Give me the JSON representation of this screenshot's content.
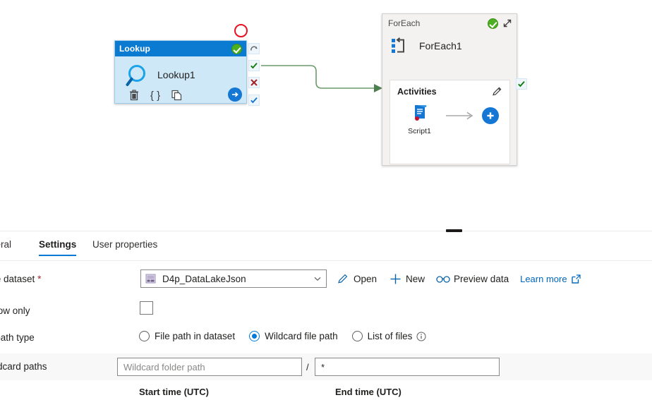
{
  "canvas": {
    "lookup_node": {
      "header_title": "Lookup",
      "name": "Lookup1",
      "status_icon": "green-check-circle-icon",
      "toolbar": [
        {
          "name": "delete-icon",
          "label": "trash"
        },
        {
          "name": "code-braces-icon",
          "label": "{}"
        },
        {
          "name": "clone-icon",
          "label": "copy"
        },
        {
          "name": "run-arrow-icon",
          "label": "arrow-right"
        }
      ],
      "side_status": [
        {
          "name": "retry-icon",
          "label": "retry"
        },
        {
          "name": "on-success-icon",
          "label": "success"
        },
        {
          "name": "on-failure-icon",
          "label": "failure"
        },
        {
          "name": "on-completion-icon",
          "label": "completion"
        }
      ],
      "breakpoint_marker": "red-circle-icon",
      "activity_icon": "lookup-magnifier-icon"
    },
    "foreach_node": {
      "header_title": "ForEach",
      "name": "ForEach1",
      "status_icon": "green-check-circle-icon",
      "collapse_icon": "collapse-arrows-icon",
      "activity_icon": "foreach-loop-icon",
      "activities_label": "Activities",
      "edit_icon": "pencil-icon",
      "inner_activity": {
        "label": "Script1",
        "icon": "script-scroll-icon"
      },
      "add_icon": "plus-circle-icon",
      "arrow_icon": "arrow-right-icon",
      "output_status_icon": "on-success-icon"
    },
    "connector": {
      "name": "success-connector",
      "color": "#6a9b6a"
    }
  },
  "panel": {
    "tabs": [
      {
        "label": "neral",
        "name": "tab-general",
        "active": false
      },
      {
        "label": "Settings",
        "name": "tab-settings",
        "active": true
      },
      {
        "label": "User properties",
        "name": "tab-user-properties",
        "active": false
      }
    ],
    "fields": {
      "source_dataset": {
        "label": "urce dataset",
        "required_marker": "*",
        "value": "D4p_DataLakeJson",
        "icon": "dataset-icon",
        "chevron": "chevron-down-icon"
      },
      "actions": [
        {
          "label": "Open",
          "icon": "pencil-icon",
          "name": "open-dataset-button"
        },
        {
          "label": "New",
          "icon": "plus-icon",
          "name": "new-dataset-button"
        },
        {
          "label": "Preview data",
          "icon": "glasses-icon",
          "name": "preview-data-button"
        }
      ],
      "learn_more": {
        "label": "Learn more",
        "icon": "external-link-icon"
      },
      "first_row_only": {
        "label": "st row only",
        "checked": false
      },
      "file_path_type": {
        "label": "e path type",
        "options": [
          {
            "label": "File path in dataset",
            "selected": false
          },
          {
            "label": "Wildcard file path",
            "selected": true
          },
          {
            "label": "List of files",
            "selected": false,
            "info_icon": "info-icon"
          }
        ]
      },
      "wildcard_paths": {
        "label": "ildcard paths",
        "folder_placeholder": "Wildcard folder path",
        "folder_value": "",
        "separator": "/",
        "file_value": "*"
      }
    },
    "table_headers": {
      "start_time": "Start time (UTC)",
      "end_time": "End time (UTC)"
    }
  },
  "colors": {
    "accent": "#0078d4",
    "node_header": "#0b7ad1",
    "node_body": "#cfe8f8",
    "success_green": "#4caf21",
    "error_red": "#e81123",
    "connector_green": "#6a9b6a"
  }
}
